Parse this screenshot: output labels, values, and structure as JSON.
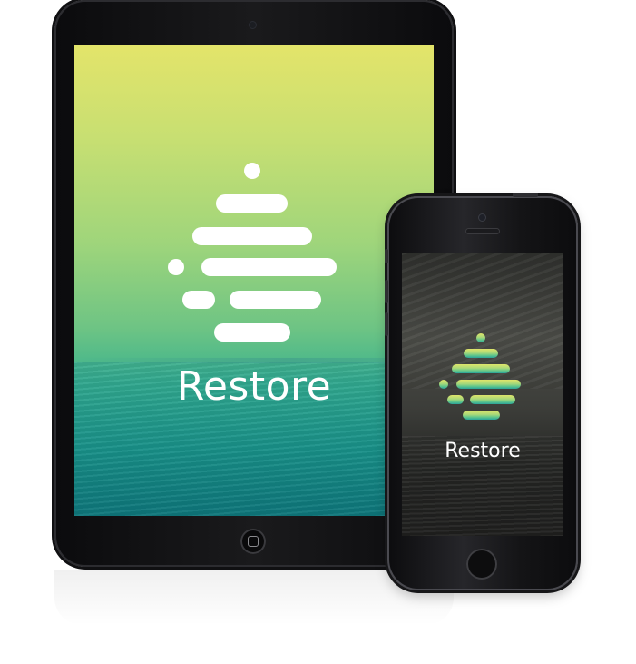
{
  "tablet": {
    "app_name": "Restore",
    "gradient_colors": [
      "#e3e46a",
      "#9fd57b",
      "#39b28e",
      "#137f82"
    ],
    "logo_color": "#ffffff"
  },
  "phone": {
    "app_name": "Restore",
    "logo_gradient": [
      "#d9e36a",
      "#a8d87a",
      "#5cc48c",
      "#2aa39a"
    ]
  },
  "icons": {
    "tablet_logo": "restore-logo-icon",
    "phone_logo": "restore-logo-icon",
    "tablet_home": "home-button-icon",
    "phone_home": "home-button-icon"
  }
}
